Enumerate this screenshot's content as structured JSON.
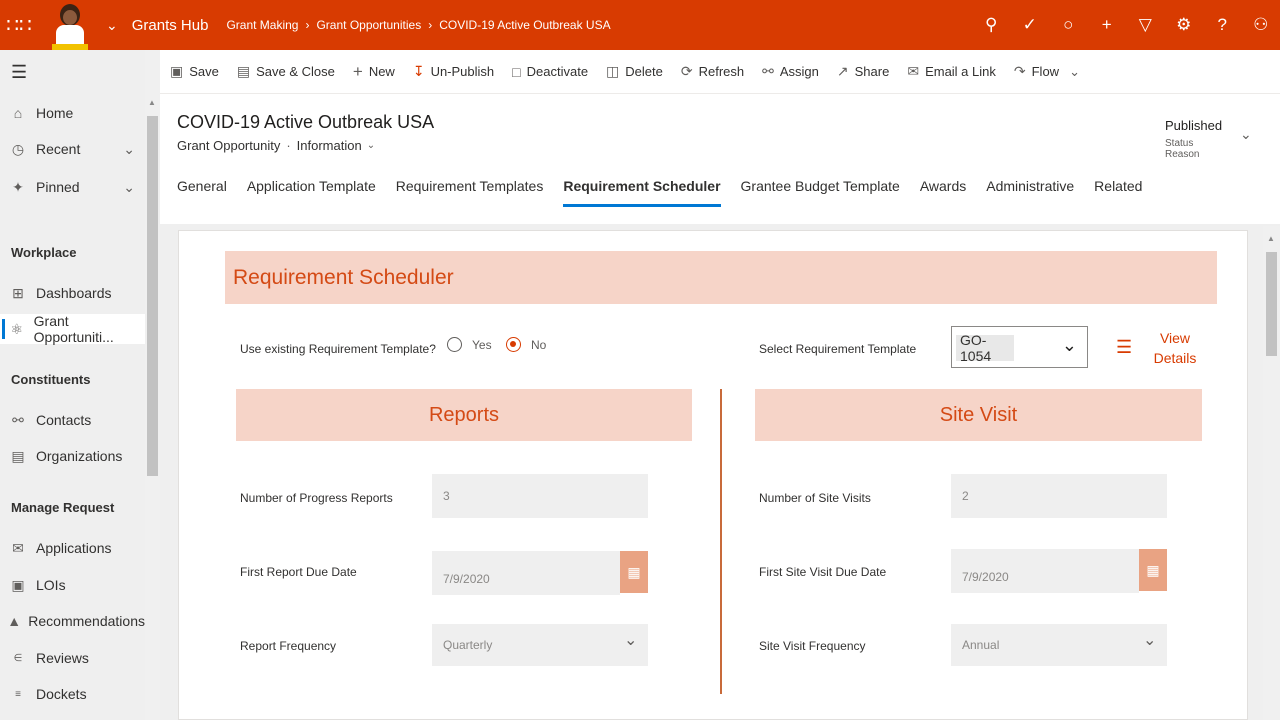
{
  "topbar": {
    "app_name": "Grants Hub",
    "breadcrumbs": [
      "Grant Making",
      "Grant Opportunities",
      "COVID-19 Active Outbreak USA"
    ],
    "icons": [
      "search-icon",
      "task-icon",
      "lightbulb-icon",
      "plus-icon",
      "filter-icon",
      "settings-icon",
      "help-icon",
      "user-icon"
    ],
    "accent": "#d83b01"
  },
  "nav": {
    "items_top": [
      {
        "label": "Home",
        "icon": "home-icon"
      },
      {
        "label": "Recent",
        "icon": "clock-icon"
      },
      {
        "label": "Pinned",
        "icon": "pin-icon"
      }
    ],
    "groups": [
      {
        "title": "Workplace",
        "items": [
          {
            "label": "Dashboards",
            "icon": "dashboard-icon"
          },
          {
            "label": "Grant Opportuniti...",
            "icon": "grant-icon"
          }
        ]
      },
      {
        "title": "Constituents",
        "items": [
          {
            "label": "Contacts",
            "icon": "person-icon"
          },
          {
            "label": "Organizations",
            "icon": "building-icon"
          }
        ]
      },
      {
        "title": "Manage Request",
        "items": [
          {
            "label": "Applications",
            "icon": "applications-icon"
          },
          {
            "label": "LOIs",
            "icon": "loi-icon"
          },
          {
            "label": "Recommendations",
            "icon": "thumbs-up-icon"
          },
          {
            "label": "Reviews",
            "icon": "review-icon"
          },
          {
            "label": "Dockets",
            "icon": "docket-icon"
          }
        ]
      }
    ]
  },
  "commands": [
    {
      "label": "Save",
      "icon": "save-icon"
    },
    {
      "label": "Save & Close",
      "icon": "save-close-icon"
    },
    {
      "label": "New",
      "icon": "plus-icon"
    },
    {
      "label": "Un-Publish",
      "icon": "unpublish-icon"
    },
    {
      "label": "Deactivate",
      "icon": "deactivate-icon"
    },
    {
      "label": "Delete",
      "icon": "trash-icon"
    },
    {
      "label": "Refresh",
      "icon": "refresh-icon"
    },
    {
      "label": "Assign",
      "icon": "assign-icon"
    },
    {
      "label": "Share",
      "icon": "share-icon"
    },
    {
      "label": "Email a Link",
      "icon": "email-icon"
    },
    {
      "label": "Flow",
      "icon": "flow-icon"
    }
  ],
  "record": {
    "title": "COVID-19 Active Outbreak USA",
    "entity": "Grant Opportunity",
    "form": "Information",
    "status_value": "Published",
    "status_label": "Status Reason"
  },
  "tabs": [
    "General",
    "Application Template",
    "Requirement Templates",
    "Requirement Scheduler",
    "Grantee Budget Template",
    "Awards",
    "Administrative",
    "Related"
  ],
  "active_tab": "Requirement Scheduler",
  "scheduler": {
    "title": "Requirement Scheduler",
    "use_existing_label": "Use existing Requirement Template?",
    "yes_label": "Yes",
    "no_label": "No",
    "selected_option": "No",
    "select_template_label": "Select Requirement Template",
    "template_value": "GO-1054",
    "view_details_label": "View Details",
    "reports": {
      "title": "Reports",
      "num_label": "Number of Progress Reports",
      "num_value": "3",
      "first_label": "First Report Due Date",
      "first_value": "7/9/2020",
      "freq_label": "Report Frequency",
      "freq_value": "Quarterly"
    },
    "site_visit": {
      "title": "Site Visit",
      "num_label": "Number of Site Visits",
      "num_value": "2",
      "first_label": "First Site Visit Due Date",
      "first_value": "7/9/2020",
      "freq_label": "Site Visit Frequency",
      "freq_value": "Annual"
    }
  }
}
